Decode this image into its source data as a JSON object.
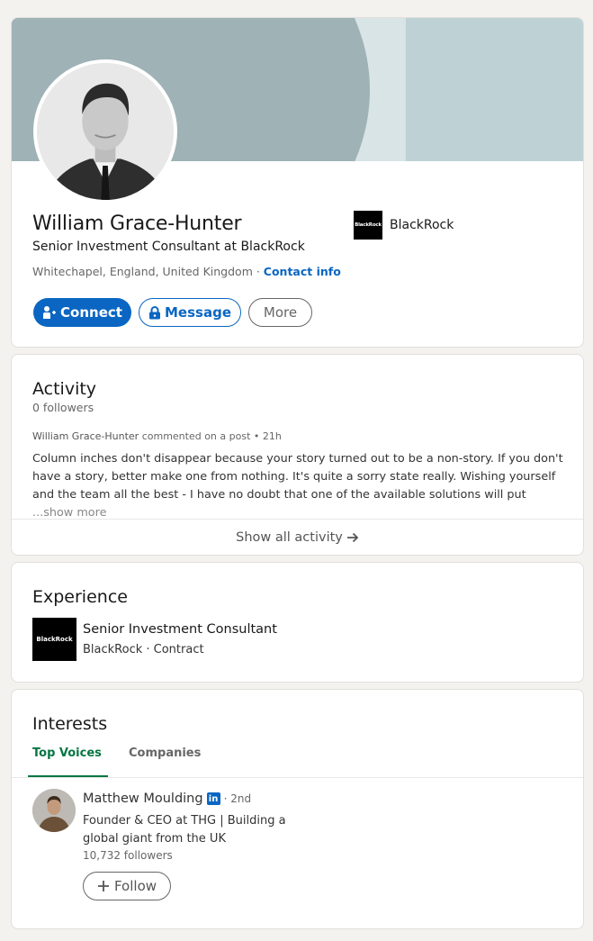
{
  "profile": {
    "name": "William Grace-Hunter",
    "headline": "Senior Investment Consultant at BlackRock",
    "location": "Whitechapel, England, United Kingdom",
    "separator": " · ",
    "contact_info_label": "Contact info",
    "current_company": {
      "name": "BlackRock",
      "logo_text": "BlackRock"
    },
    "avatar_icon": "profile-photo",
    "banner_colors": {
      "left": "#9fb2b6",
      "stripe": "#d8e4e6",
      "right": "#bed2d6"
    },
    "actions": {
      "connect_label": "Connect",
      "connect_icon": "add-person-icon",
      "message_label": "Message",
      "message_icon": "lock-icon",
      "more_label": "More"
    }
  },
  "activity": {
    "title": "Activity",
    "followers": "0 followers",
    "post": {
      "author": "William Grace-Hunter",
      "action": " commented on a post • 21h",
      "text": "Column inches don't disappear because your story turned out to be a non-story. If you don't have a story, better make one from nothing. It's quite a sorry state really. Wishing yourself and the team all the best - I have no doubt that one of the available solutions will put ",
      "show_more_label": " ...show more"
    },
    "show_all_label": "Show all activity",
    "show_all_icon": "arrow-right-icon"
  },
  "experience": {
    "title": "Experience",
    "items": [
      {
        "logo_text": "BlackRock",
        "title": "Senior Investment Consultant",
        "subtitle": "BlackRock · Contract"
      }
    ]
  },
  "interests": {
    "title": "Interests",
    "tabs": [
      {
        "label": "Top Voices",
        "active": true
      },
      {
        "label": "Companies",
        "active": false
      }
    ],
    "items": [
      {
        "name": "Matthew Moulding",
        "badge": "in",
        "degree": "· 2nd",
        "headline": "Founder & CEO at THG | Building a global giant from the UK",
        "followers": "10,732 followers",
        "follow_label": "Follow",
        "follow_icon": "plus-icon"
      }
    ]
  },
  "colors": {
    "primary": "#0a66c2",
    "tab_active": "#057642",
    "page_bg": "#f3f2ef"
  }
}
